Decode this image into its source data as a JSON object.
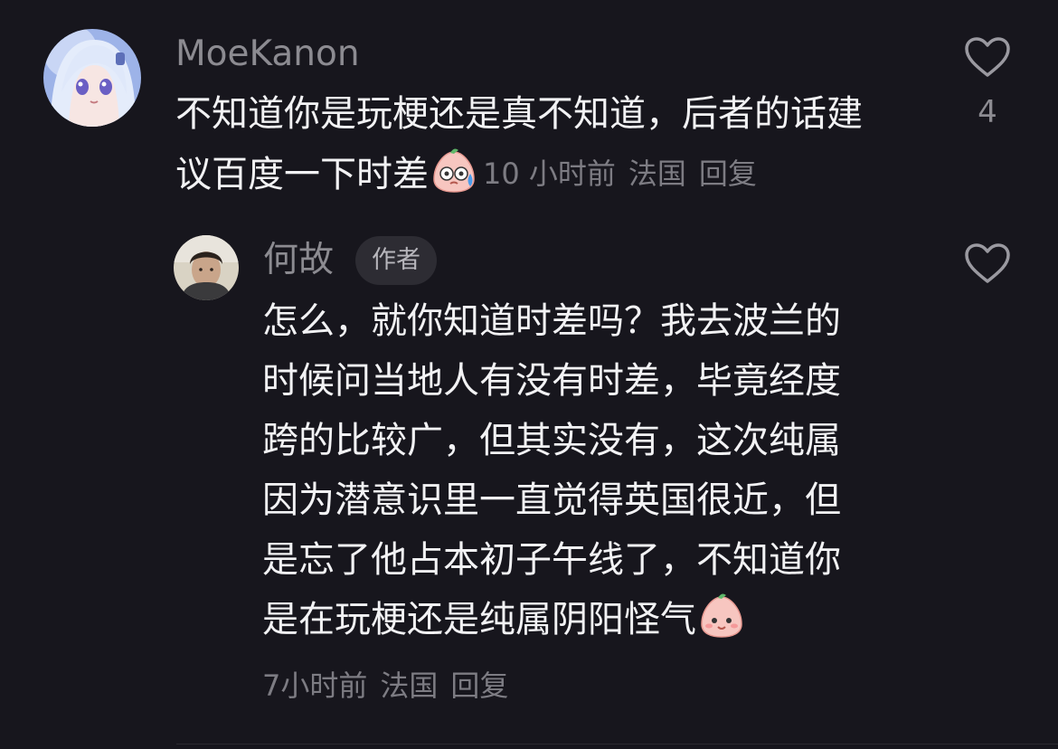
{
  "comments": [
    {
      "username": "MoeKanon",
      "text_lines": [
        "不知道你是玩梗还是真不知道，后者的话建",
        "议百度一下时差"
      ],
      "emoji": "sweat-smile-peach-emoji",
      "time": "10 小时前",
      "location": "法国",
      "reply_label": "回复",
      "like_count": "4",
      "avatar": "anime-girl-avatar"
    },
    {
      "username": "何故",
      "badge": "作者",
      "text_lines": [
        "怎么，就你知道时差吗？我去波兰的",
        "时候问当地人有没有时差，毕竟经度",
        "跨的比较广，但其实没有，这次纯属",
        "因为潜意识里一直觉得英国很近，但",
        "是忘了他占本初子午线了，不知道你",
        "是在玩梗还是纯属阴阳怪气"
      ],
      "emoji": "smile-peach-emoji",
      "time": "7小时前",
      "location": "法国",
      "reply_label": "回复",
      "avatar": "man-photo-avatar"
    }
  ],
  "colors": {
    "background": "#17161d",
    "text": "#f2f2f4",
    "muted": "#7d7c83",
    "badge_bg": "#2d2c33"
  },
  "icons": {
    "like": "heart-outline-icon"
  }
}
